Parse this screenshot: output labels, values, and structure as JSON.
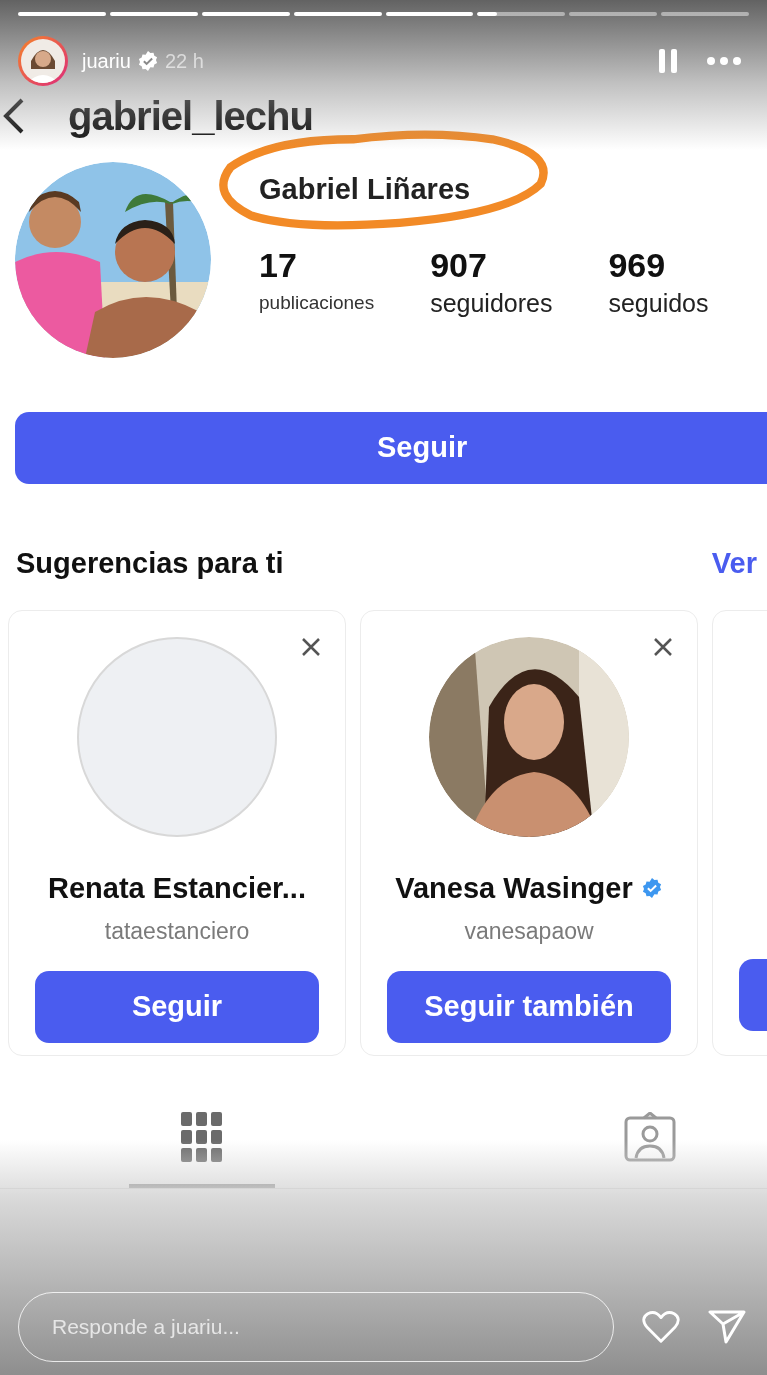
{
  "story": {
    "segments": [
      {
        "kind": "seen"
      },
      {
        "kind": "seen"
      },
      {
        "kind": "seen"
      },
      {
        "kind": "seen"
      },
      {
        "kind": "seen"
      },
      {
        "kind": "current",
        "level": 0.22
      },
      {
        "kind": "unseen"
      },
      {
        "kind": "unseen"
      }
    ],
    "user": "juariu",
    "verified": true,
    "time": "22 h",
    "paused": true
  },
  "profile": {
    "username": "gabriel_lechu",
    "name": "Gabriel Liñares",
    "stats": [
      {
        "value": "17",
        "label": "publicaciones"
      },
      {
        "value": "907",
        "label": "seguidores"
      },
      {
        "value": "969",
        "label": "seguidos"
      }
    ],
    "follow_button": "Seguir"
  },
  "suggestions": {
    "title": "Sugerencias para ti",
    "see_all": "Ver",
    "cards": [
      {
        "kind": "blank",
        "name": "Renata Estancier...",
        "handle": "tataestanciero",
        "verified": false,
        "button": "Seguir"
      },
      {
        "kind": "picture",
        "name": "Vanesa Wasinger",
        "handle": "vanesapaow",
        "verified": true,
        "button": "Seguir también"
      }
    ]
  },
  "tabs": [
    {
      "kind": "grid",
      "selected": true
    },
    {
      "kind": "tagged",
      "selected": false
    }
  ],
  "reply": {
    "placeholder": "Responde a juariu..."
  }
}
